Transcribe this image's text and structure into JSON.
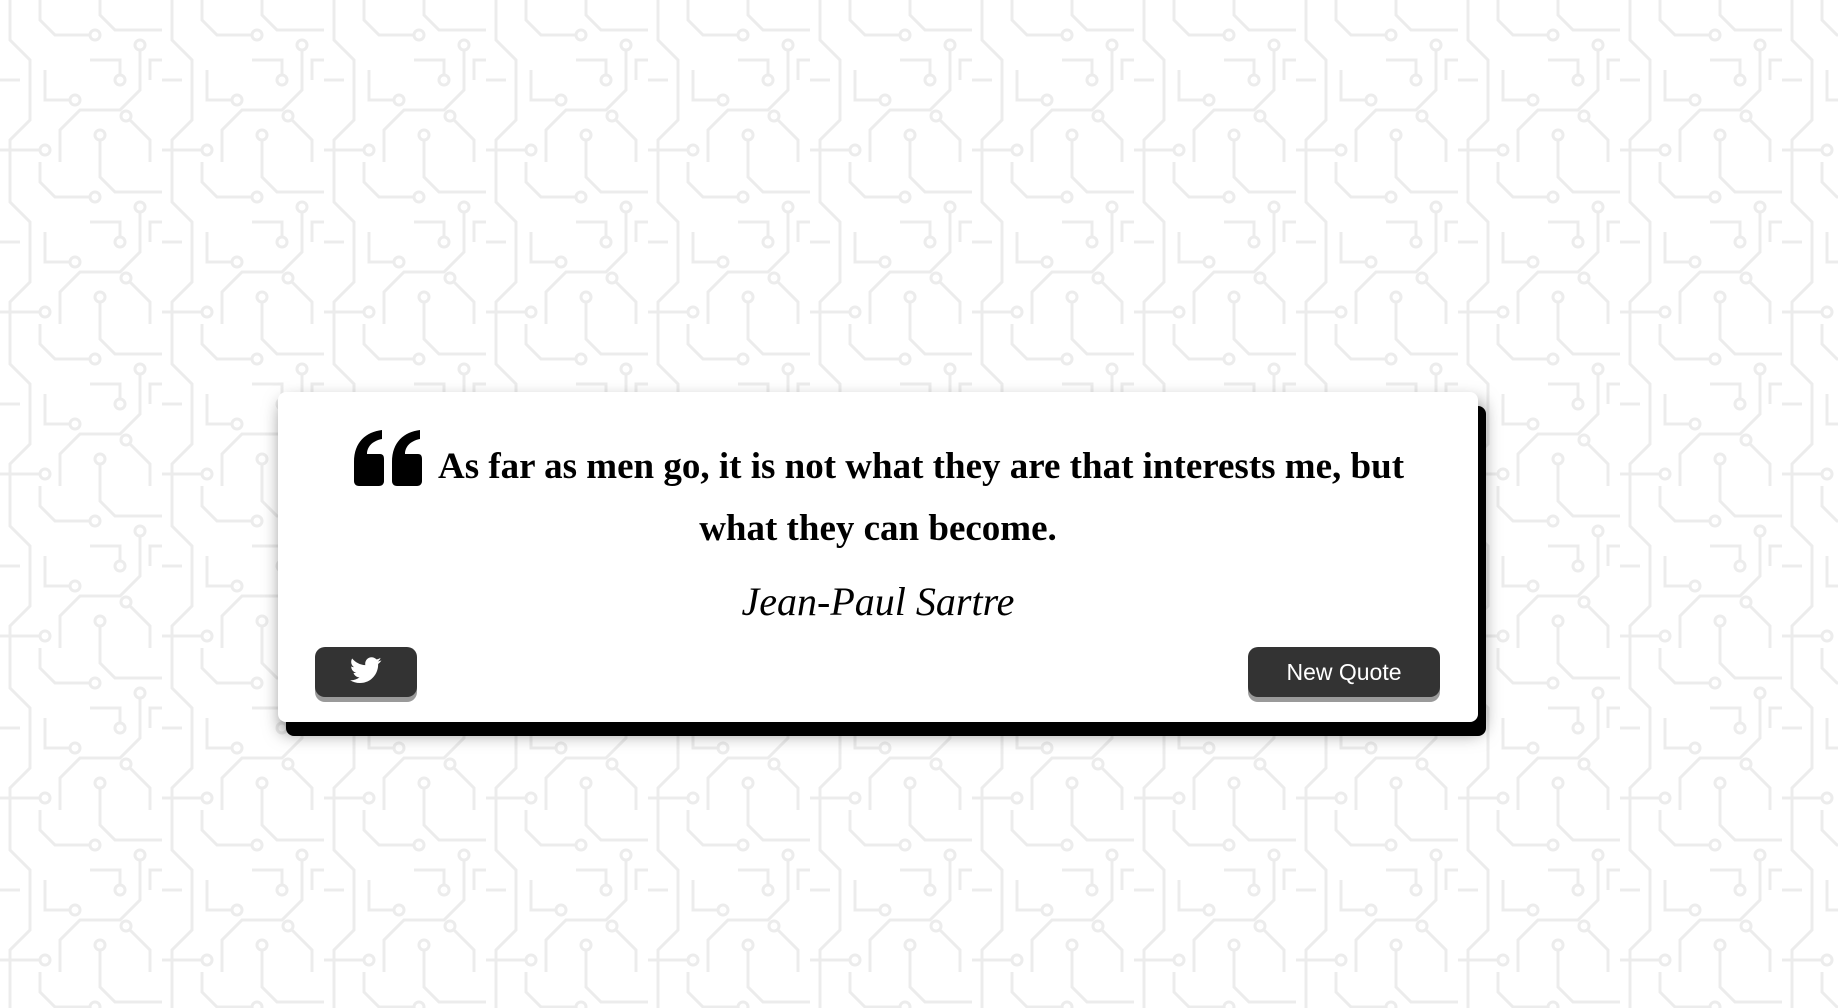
{
  "quote": {
    "text": "As far as men go, it is not what they are that interests me, but what they can become.",
    "author": "Jean-Paul Sartre",
    "icon": "quote-left-icon"
  },
  "buttons": {
    "tweet_icon": "twitter-icon",
    "new_quote_label": "New Quote"
  },
  "colors": {
    "button_bg": "#333333",
    "card_bg": "#ffffff",
    "pattern_stroke": "#eeeeee"
  }
}
